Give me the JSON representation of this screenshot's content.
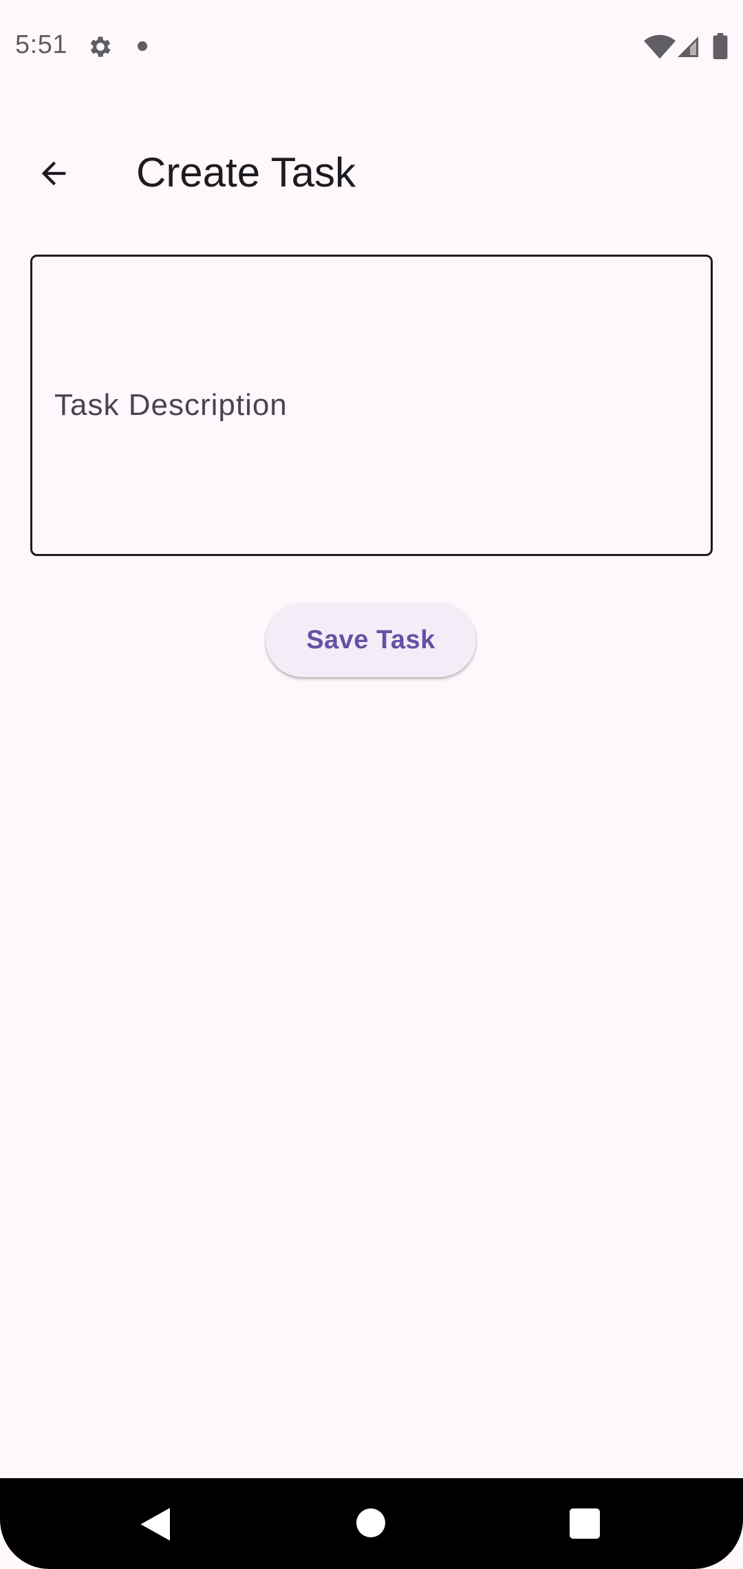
{
  "status_bar": {
    "time": "5:51",
    "icons": [
      "gear-icon",
      "notification-dot-icon",
      "wifi-icon",
      "cell-signal-icon",
      "battery-icon"
    ]
  },
  "app_bar": {
    "back_icon": "arrow-left-icon",
    "title": "Create Task"
  },
  "form": {
    "task_description": {
      "label": "Task Description",
      "value": ""
    },
    "save_label": "Save Task"
  },
  "nav_bar": {
    "icons": [
      "nav-back-icon",
      "nav-home-icon",
      "nav-recents-icon"
    ]
  },
  "colors": {
    "background": "#fef7fb",
    "primary": "#6750a4",
    "button_container": "#f3edf7",
    "on_surface": "#1c1b1f",
    "on_surface_variant": "#49454f"
  }
}
